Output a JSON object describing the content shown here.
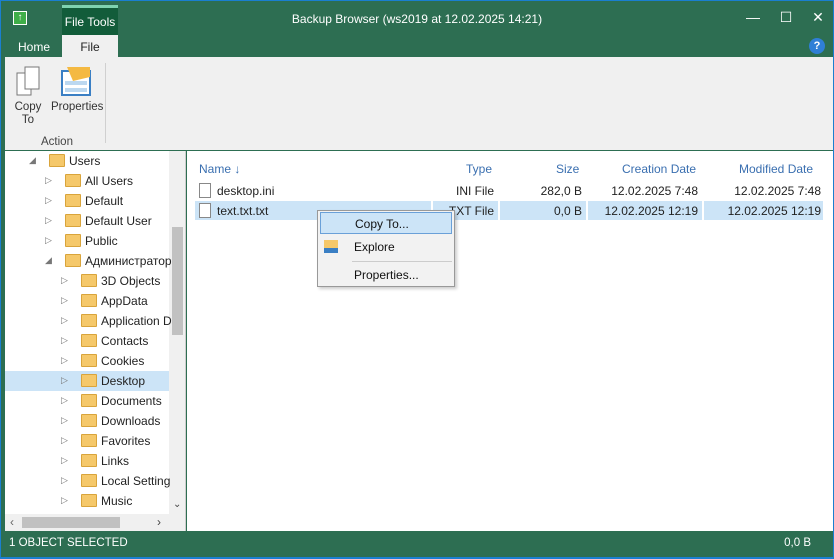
{
  "window": {
    "title": "Backup Browser (ws2019 at 12.02.2025 14:21)",
    "context_tab": "File Tools"
  },
  "tabs": [
    {
      "label": "Home"
    },
    {
      "label": "File"
    }
  ],
  "ribbon": {
    "copy_to": "Copy To",
    "properties": "Properties",
    "group": "Action"
  },
  "tree": [
    {
      "label": "Users",
      "level": 0,
      "expanded": true
    },
    {
      "label": "All Users",
      "level": 1
    },
    {
      "label": "Default",
      "level": 1
    },
    {
      "label": "Default User",
      "level": 1
    },
    {
      "label": "Public",
      "level": 1
    },
    {
      "label": "Администратор",
      "level": 1,
      "expanded": true
    },
    {
      "label": "3D Objects",
      "level": 2
    },
    {
      "label": "AppData",
      "level": 2
    },
    {
      "label": "Application D",
      "level": 2
    },
    {
      "label": "Contacts",
      "level": 2
    },
    {
      "label": "Cookies",
      "level": 2
    },
    {
      "label": "Desktop",
      "level": 2,
      "selected": true
    },
    {
      "label": "Documents",
      "level": 2
    },
    {
      "label": "Downloads",
      "level": 2
    },
    {
      "label": "Favorites",
      "level": 2
    },
    {
      "label": "Links",
      "level": 2
    },
    {
      "label": "Local Setting",
      "level": 2
    },
    {
      "label": "Music",
      "level": 2
    }
  ],
  "columns": {
    "name": "Name ↓",
    "type": "Type",
    "size": "Size",
    "created": "Creation Date",
    "modified": "Modified Date"
  },
  "files": [
    {
      "name": "desktop.ini",
      "type": "INI  File",
      "size": "282,0 B",
      "created": "12.02.2025 7:48",
      "modified": "12.02.2025 7:48"
    },
    {
      "name": "text.txt.txt",
      "type": "TXT  File",
      "size": "0,0 B",
      "created": "12.02.2025 12:19",
      "modified": "12.02.2025 12:19",
      "selected": true
    }
  ],
  "context_menu": [
    {
      "label": "Copy To..."
    },
    {
      "label": "Explore"
    },
    {
      "label": "Properties..."
    }
  ],
  "status": {
    "left": "1 OBJECT SELECTED",
    "right": "0,0 B"
  },
  "colors": {
    "accent": "#2d6e52",
    "selection": "#cce4f7"
  }
}
